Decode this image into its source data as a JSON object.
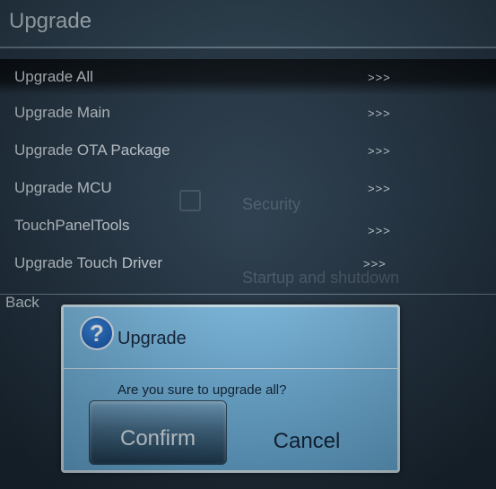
{
  "screen": {
    "title": "Upgrade"
  },
  "menu": {
    "items": [
      {
        "label": "Upgrade All",
        "arrow": ">>>",
        "selected": true
      },
      {
        "label": "Upgrade Main",
        "arrow": ">>>",
        "selected": false
      },
      {
        "label": "Upgrade OTA Package",
        "arrow": ">>>",
        "selected": false
      },
      {
        "label": "Upgrade MCU",
        "arrow": ">>>",
        "selected": false
      },
      {
        "label": "TouchPanelTools",
        "arrow": ">>>",
        "selected": false
      },
      {
        "label": "Upgrade Touch Driver",
        "arrow": ">>>",
        "selected": false
      },
      {
        "label": "Back",
        "arrow": "",
        "selected": false
      }
    ]
  },
  "background_screen": {
    "item_security": "Security",
    "item_startup": "Startup and shutdown"
  },
  "dialog": {
    "icon": "question-icon",
    "title": "Upgrade",
    "message": "Are you sure to upgrade all?",
    "confirm_label": "Confirm",
    "cancel_label": "Cancel"
  },
  "colors": {
    "dialog_bg": "#7fc0e8",
    "title_bar": "#2f4556",
    "selected_row": "#0b1117"
  }
}
